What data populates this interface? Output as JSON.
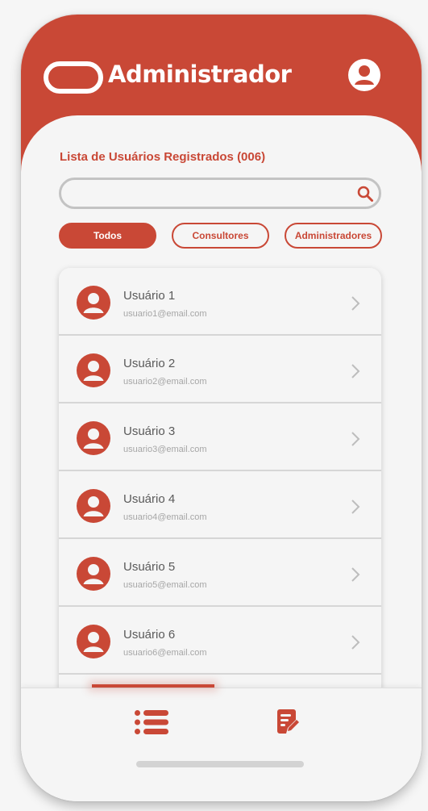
{
  "header": {
    "title": "Administrador",
    "logo_icon": "pill-outline-icon",
    "profile_icon": "user-circle-icon"
  },
  "list": {
    "heading": "Lista de Usuários Registrados (006)"
  },
  "search": {
    "value": "",
    "placeholder": "",
    "icon": "search-icon"
  },
  "filters": [
    {
      "label": "Todos",
      "active": true
    },
    {
      "label": "Consultores",
      "active": false
    },
    {
      "label": "Administradores",
      "active": false
    }
  ],
  "users": [
    {
      "name": "Usuário 1",
      "email": "usuario1@email.com"
    },
    {
      "name": "Usuário 2",
      "email": "usuario2@email.com"
    },
    {
      "name": "Usuário 3",
      "email": "usuario3@email.com"
    },
    {
      "name": "Usuário 4",
      "email": "usuario4@email.com"
    },
    {
      "name": "Usuário 5",
      "email": "usuario5@email.com"
    },
    {
      "name": "Usuário 6",
      "email": "usuario6@email.com"
    }
  ],
  "bottom_nav": {
    "items": [
      {
        "icon": "list-icon",
        "active": true
      },
      {
        "icon": "edit-document-icon",
        "active": false
      }
    ]
  },
  "colors": {
    "accent": "#c94836",
    "background": "#f5f5f5",
    "text_primary": "#5a5a5a",
    "text_secondary": "#a6a6a6"
  }
}
